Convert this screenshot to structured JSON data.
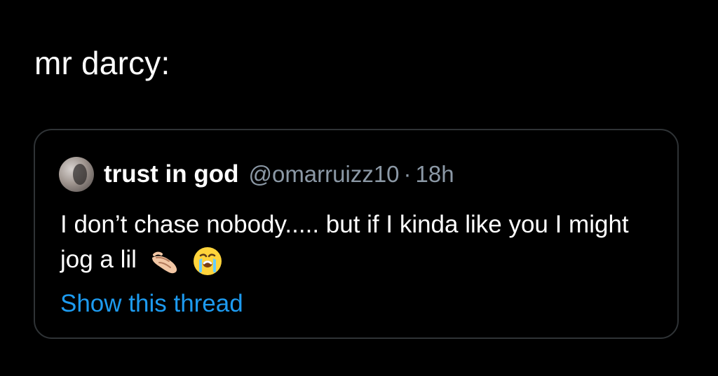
{
  "caption": "mr darcy:",
  "tweet": {
    "display_name": "trust in god",
    "handle": "@omarruizz10",
    "separator": "·",
    "time": "18h",
    "text": "I don’t chase nobody..... but if I kinda like you I might jog a lil",
    "emojis": [
      "hand-pointing-icon",
      "crying-face-icon"
    ],
    "show_thread_label": "Show this thread"
  },
  "colors": {
    "background": "#000000",
    "text": "#ffffff",
    "secondary": "#8b98a5",
    "link": "#1d9bf0",
    "border": "#2f3336"
  }
}
